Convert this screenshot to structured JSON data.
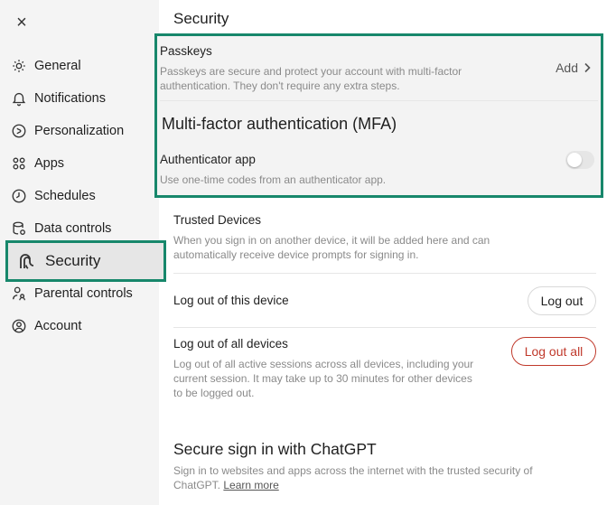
{
  "close": {
    "label": "×"
  },
  "sidebar": {
    "items": [
      {
        "label": "General",
        "icon": "gear-icon"
      },
      {
        "label": "Notifications",
        "icon": "bell-icon"
      },
      {
        "label": "Personalization",
        "icon": "personalization-icon"
      },
      {
        "label": "Apps",
        "icon": "apps-grid-icon"
      },
      {
        "label": "Schedules",
        "icon": "clock-icon"
      },
      {
        "label": "Data controls",
        "icon": "database-icon"
      },
      {
        "label": "Security",
        "icon": "security-icon",
        "active": true
      },
      {
        "label": "Parental controls",
        "icon": "parental-icon"
      },
      {
        "label": "Account",
        "icon": "account-icon"
      }
    ]
  },
  "main": {
    "title": "Security",
    "passkeys": {
      "title": "Passkeys",
      "description": "Passkeys are secure and protect your account with multi-factor authentication. They don't require any extra steps.",
      "action_label": "Add"
    },
    "mfa": {
      "title": "Multi-factor authentication (MFA)",
      "authenticator": {
        "title": "Authenticator app",
        "description": "Use one-time codes from an authenticator app.",
        "enabled": false
      }
    },
    "trusted_devices": {
      "title": "Trusted Devices",
      "description": "When you sign in on another device, it will be added here and can automatically receive device prompts for signing in."
    },
    "logout_device": {
      "title": "Log out of this device",
      "button_label": "Log out"
    },
    "logout_all": {
      "title": "Log out of all devices",
      "description": "Log out of all active sessions across all devices, including your current session. It may take up to 30 minutes for other devices to be logged out.",
      "button_label": "Log out all"
    },
    "secure_signin": {
      "title": "Secure sign in with ChatGPT",
      "description": "Sign in to websites and apps across the internet with the trusted security of ChatGPT.",
      "learn_more": "Learn more"
    }
  },
  "colors": {
    "highlight": "#17876b",
    "danger": "#c0392b",
    "sidebar_bg": "#f4f4f4"
  }
}
